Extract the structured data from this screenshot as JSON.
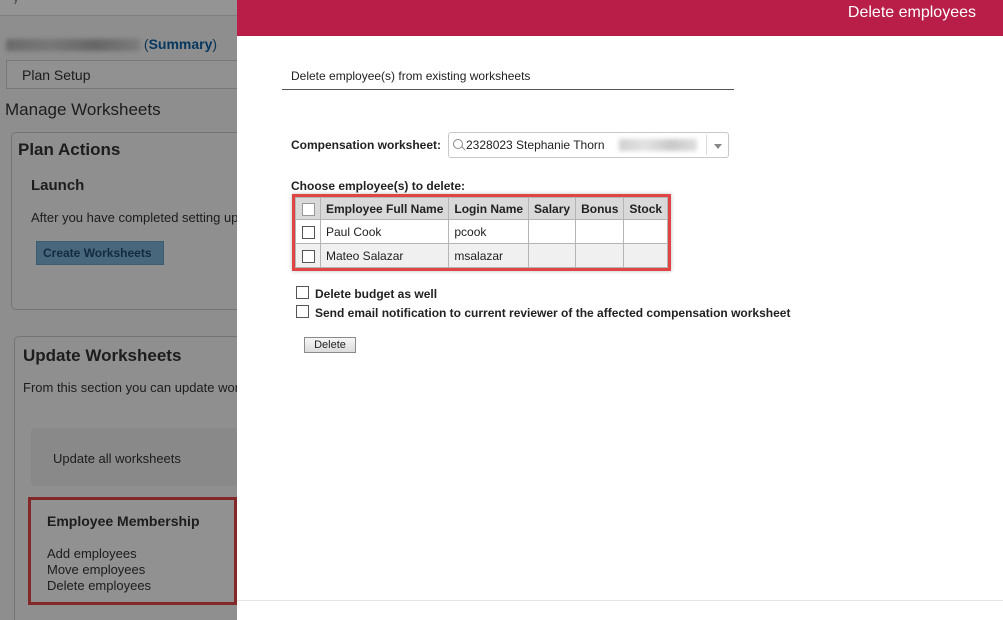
{
  "background": {
    "plan_title_paren_open": "(",
    "summary_link": "Summary",
    "plan_title_paren_close": ")",
    "plan_setup_tab": "Plan Setup",
    "manage_title": "Manage Worksheets",
    "plan_actions": {
      "title": "Plan Actions",
      "launch_heading": "Launch",
      "launch_text": "After you have completed setting up",
      "create_button": "Create Worksheets"
    },
    "update_worksheets": {
      "title": "Update Worksheets",
      "text": "From this section you can update wor",
      "update_all": "Update all worksheets"
    },
    "employee_membership": {
      "title": "Employee Membership",
      "items": [
        "Add employees",
        "Move employees",
        "Delete employees"
      ]
    }
  },
  "dialog": {
    "header_title": "Delete employees",
    "subtitle": "Delete employee(s) from existing worksheets",
    "worksheet_label": "Compensation worksheet:",
    "worksheet_value": "2328023 Stephanie Thorn",
    "choose_label": "Choose employee(s) to delete:",
    "table": {
      "columns": [
        "Employee Full Name",
        "Login Name",
        "Salary",
        "Bonus",
        "Stock"
      ],
      "rows": [
        {
          "name": "Paul Cook",
          "login": "pcook",
          "salary": "",
          "bonus": "",
          "stock": ""
        },
        {
          "name": "Mateo Salazar",
          "login": "msalazar",
          "salary": "",
          "bonus": "",
          "stock": ""
        }
      ]
    },
    "option_delete_budget": "Delete budget as well",
    "option_send_email": "Send email notification to current reviewer of the affected compensation worksheet",
    "delete_button": "Delete"
  },
  "colors": {
    "header_bg": "#b91e48",
    "highlight_border": "#e04545",
    "overlay": "rgba(0,0,0,0.42)"
  }
}
